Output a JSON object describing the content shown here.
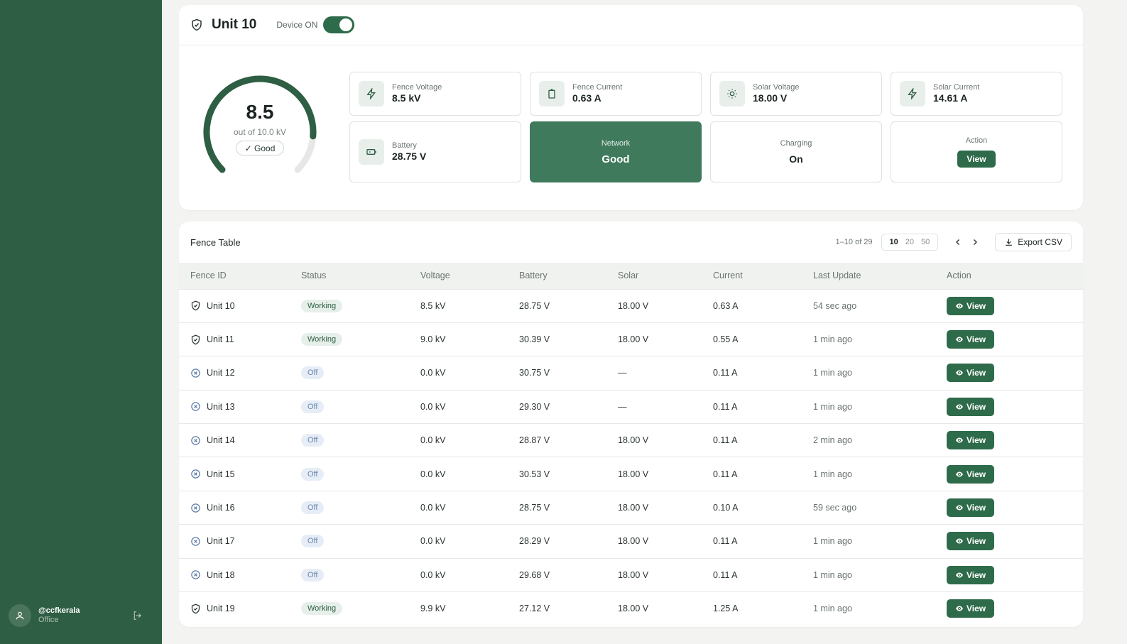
{
  "user": {
    "handle": "@ccfkerala",
    "role": "Office"
  },
  "device": {
    "title": "Unit 10",
    "toggle_label": "Device ON",
    "toggle_on": true,
    "gauge": {
      "value": "8.5",
      "max_text": "out of 10.0 kV",
      "status": "✓ Good",
      "fraction": 0.85
    },
    "metrics": [
      {
        "label": "Fence Voltage",
        "value": "8.5 kV",
        "icon": "bolt-icon"
      },
      {
        "label": "Fence Current",
        "value": "0.63 A",
        "icon": "battery-upright-icon"
      },
      {
        "label": "Solar Voltage",
        "value": "18.00 V",
        "icon": "sun-icon"
      },
      {
        "label": "Solar Current",
        "value": "14.61 A",
        "icon": "bolt-icon"
      },
      {
        "label": "Battery",
        "value": "28.75 V",
        "icon": "battery-icon"
      }
    ],
    "network": {
      "label": "Network",
      "value": "Good"
    },
    "charging": {
      "label": "Charging",
      "value": "On"
    },
    "action": {
      "label": "Action",
      "button": "View"
    }
  },
  "table": {
    "title": "Fence Table",
    "range": "1–10 of 29",
    "page_sizes": [
      "10",
      "20",
      "50"
    ],
    "active_page_size": "10",
    "export_label": "Export CSV",
    "columns": [
      "Fence ID",
      "Status",
      "Voltage",
      "Battery",
      "Solar",
      "Current",
      "Last Update",
      "Action"
    ],
    "rows": [
      {
        "id": "Unit 10",
        "status": "Working",
        "voltage": "8.5 kV",
        "battery": "28.75 V",
        "solar": "18.00 V",
        "current": "0.63 A",
        "updated": "54 sec ago",
        "action": "View"
      },
      {
        "id": "Unit 11",
        "status": "Working",
        "voltage": "9.0 kV",
        "battery": "30.39 V",
        "solar": "18.00 V",
        "current": "0.55 A",
        "updated": "1 min ago",
        "action": "View"
      },
      {
        "id": "Unit 12",
        "status": "Off",
        "voltage": "0.0 kV",
        "battery": "30.75 V",
        "solar": "—",
        "current": "0.11 A",
        "updated": "1 min ago",
        "action": "View"
      },
      {
        "id": "Unit 13",
        "status": "Off",
        "voltage": "0.0 kV",
        "battery": "29.30 V",
        "solar": "—",
        "current": "0.11 A",
        "updated": "1 min ago",
        "action": "View"
      },
      {
        "id": "Unit 14",
        "status": "Off",
        "voltage": "0.0 kV",
        "battery": "28.87 V",
        "solar": "18.00 V",
        "current": "0.11 A",
        "updated": "2 min ago",
        "action": "View"
      },
      {
        "id": "Unit 15",
        "status": "Off",
        "voltage": "0.0 kV",
        "battery": "30.53 V",
        "solar": "18.00 V",
        "current": "0.11 A",
        "updated": "1 min ago",
        "action": "View"
      },
      {
        "id": "Unit 16",
        "status": "Off",
        "voltage": "0.0 kV",
        "battery": "28.75 V",
        "solar": "18.00 V",
        "current": "0.10 A",
        "updated": "59 sec ago",
        "action": "View"
      },
      {
        "id": "Unit 17",
        "status": "Off",
        "voltage": "0.0 kV",
        "battery": "28.29 V",
        "solar": "18.00 V",
        "current": "0.11 A",
        "updated": "1 min ago",
        "action": "View"
      },
      {
        "id": "Unit 18",
        "status": "Off",
        "voltage": "0.0 kV",
        "battery": "29.68 V",
        "solar": "18.00 V",
        "current": "0.11 A",
        "updated": "1 min ago",
        "action": "View"
      },
      {
        "id": "Unit 19",
        "status": "Working",
        "voltage": "9.9 kV",
        "battery": "27.12 V",
        "solar": "18.00 V",
        "current": "1.25 A",
        "updated": "1 min ago",
        "action": "View"
      }
    ]
  },
  "colors": {
    "sidebar": "#2e5e43",
    "accent": "#2e6b4a",
    "network_tile": "#3f7a5c",
    "off_pill": "#e6edf6",
    "working_pill": "#e6efe9"
  }
}
